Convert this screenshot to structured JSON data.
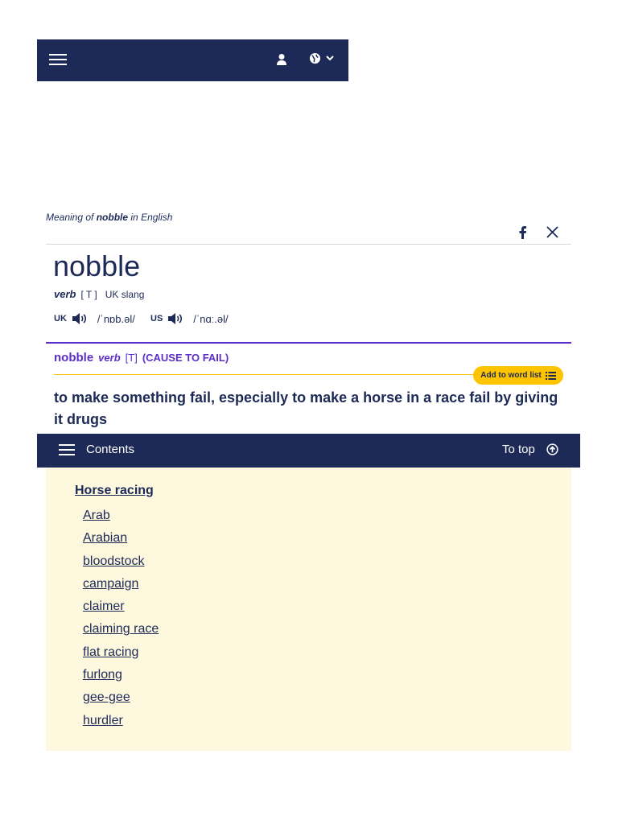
{
  "header": {
    "menu_icon": "hamburger-icon",
    "user_icon": "user-icon",
    "language_icon": "globe-icon",
    "chevron_icon": "chevron-down-icon"
  },
  "entry": {
    "meaning_prefix": "Meaning of",
    "meaning_word": "nobble",
    "meaning_suffix": "in English",
    "headword": "nobble",
    "pos": "verb",
    "grammar": "[ T ]",
    "usage": "UK slang",
    "uk_label": "UK",
    "uk_ipa": "/ˈnɒb.əl/",
    "us_label": "US",
    "us_ipa": "/ˈnɑː.əl/"
  },
  "sense": {
    "headword": "nobble",
    "pos": "verb",
    "grammar": "[T]",
    "guideword": "(CAUSE TO FAIL)",
    "add_to_word_list": "Add to word list",
    "definition": "to make something fail, especially to make a horse in a race fail by giving it drugs"
  },
  "share": {
    "facebook_icon": "facebook-icon",
    "x_icon": "x-icon"
  },
  "contents_bar": {
    "label": "Contents",
    "to_top": "To top"
  },
  "related": {
    "title": "Horse racing",
    "words": [
      "Arab",
      "Arabian",
      "bloodstock",
      "campaign",
      "claimer",
      "claiming race",
      "flat racing",
      "furlong",
      "gee-gee",
      "hurdler"
    ]
  },
  "colors": {
    "navy": "#1d2a57",
    "purple": "#5b2ec9",
    "yellow": "#fec400",
    "panel": "#fef8df"
  }
}
